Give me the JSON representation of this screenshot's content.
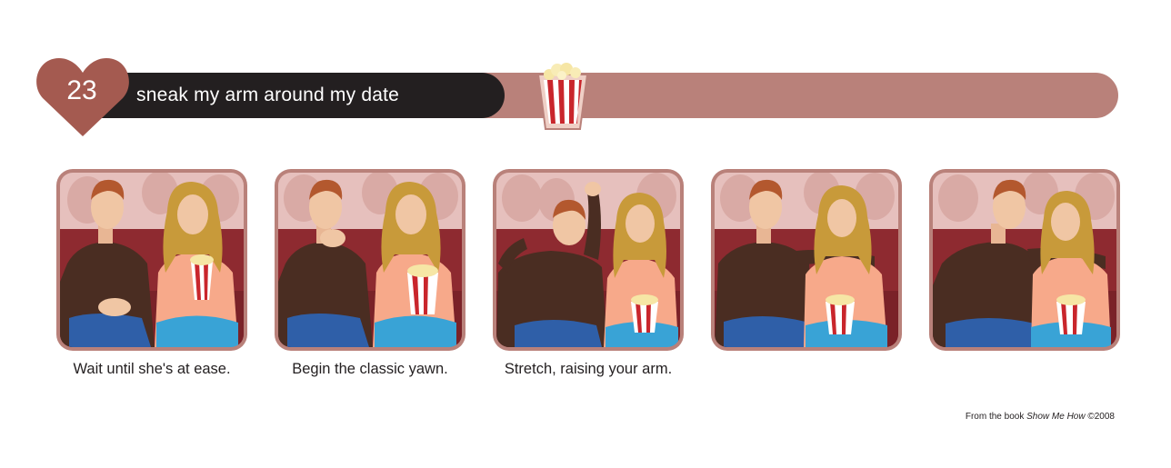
{
  "step": {
    "number": "23",
    "title": "sneak my arm around my date"
  },
  "panels": [
    {
      "caption": "Wait until she's at ease."
    },
    {
      "caption": "Begin the classic yawn."
    },
    {
      "caption": "Stretch, raising your arm."
    },
    {
      "caption": ""
    },
    {
      "caption": ""
    }
  ],
  "credit": {
    "prefix": "From the book ",
    "book_title": "Show Me How",
    "suffix": " ©2008"
  },
  "colors": {
    "accent": "#b9817a",
    "title_bar": "#231f20",
    "heart": "#a45a50",
    "seat": "#8e2a30",
    "popcorn_stripe": "#c9262c"
  }
}
